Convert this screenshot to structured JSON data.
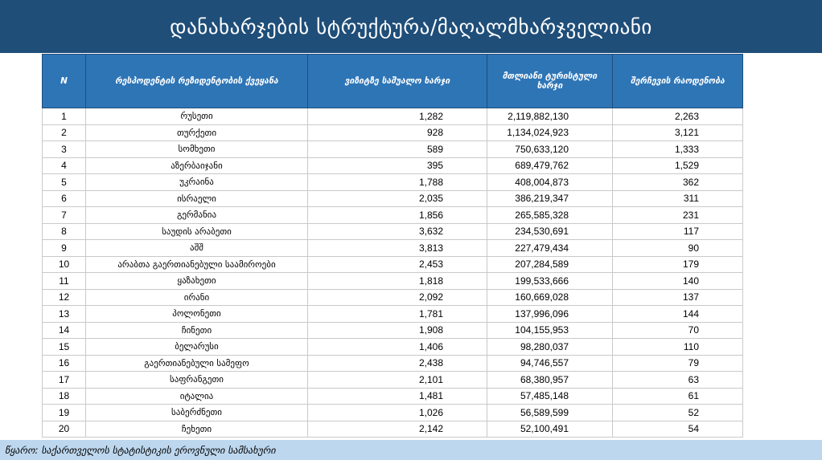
{
  "title": "დანახარჯების სტრუქტურა/მაღალმხარჯველიანი",
  "table": {
    "headers": [
      "N",
      "რესპოდენტის რეზიდენტობის ქვეყანა",
      "ვიზიტზე საშუალო ხარჯი",
      "მთლიანი ტურისტული ხარჯი",
      "შერჩევის რაოდენობა"
    ],
    "rows": [
      {
        "n": "1",
        "country": "რუსეთი",
        "avg": "1,282",
        "total": "2,119,882,130",
        "sample": "2,263"
      },
      {
        "n": "2",
        "country": "თურქეთი",
        "avg": "928",
        "total": "1,134,024,923",
        "sample": "3,121"
      },
      {
        "n": "3",
        "country": "სომხეთი",
        "avg": "589",
        "total": "750,633,120",
        "sample": "1,333"
      },
      {
        "n": "4",
        "country": "აზერბაიჯანი",
        "avg": "395",
        "total": "689,479,762",
        "sample": "1,529"
      },
      {
        "n": "5",
        "country": "უკრაინა",
        "avg": "1,788",
        "total": "408,004,873",
        "sample": "362"
      },
      {
        "n": "6",
        "country": "ისრაელი",
        "avg": "2,035",
        "total": "386,219,347",
        "sample": "311"
      },
      {
        "n": "7",
        "country": "გერმანია",
        "avg": "1,856",
        "total": "265,585,328",
        "sample": "231"
      },
      {
        "n": "8",
        "country": "საუდის არაბეთი",
        "avg": "3,632",
        "total": "234,530,691",
        "sample": "117"
      },
      {
        "n": "9",
        "country": "აშშ",
        "avg": "3,813",
        "total": "227,479,434",
        "sample": "90"
      },
      {
        "n": "10",
        "country": "არაბთა გაერთიანებული საამიროები",
        "avg": "2,453",
        "total": "207,284,589",
        "sample": "179"
      },
      {
        "n": "11",
        "country": "ყაზახეთი",
        "avg": "1,818",
        "total": "199,533,666",
        "sample": "140"
      },
      {
        "n": "12",
        "country": "ირანი",
        "avg": "2,092",
        "total": "160,669,028",
        "sample": "137"
      },
      {
        "n": "13",
        "country": "პოლონეთი",
        "avg": "1,781",
        "total": "137,996,096",
        "sample": "144"
      },
      {
        "n": "14",
        "country": "ჩინეთი",
        "avg": "1,908",
        "total": "104,155,953",
        "sample": "70"
      },
      {
        "n": "15",
        "country": "ბელარუსი",
        "avg": "1,406",
        "total": "98,280,037",
        "sample": "110"
      },
      {
        "n": "16",
        "country": "გაერთიანებული სამეფო",
        "avg": "2,438",
        "total": "94,746,557",
        "sample": "79"
      },
      {
        "n": "17",
        "country": "საფრანგეთი",
        "avg": "2,101",
        "total": "68,380,957",
        "sample": "63"
      },
      {
        "n": "18",
        "country": "იტალია",
        "avg": "1,481",
        "total": "57,485,148",
        "sample": "61"
      },
      {
        "n": "19",
        "country": "საბერძნეთი",
        "avg": "1,026",
        "total": "56,589,599",
        "sample": "52"
      },
      {
        "n": "20",
        "country": "ჩეხეთი",
        "avg": "2,142",
        "total": "52,100,491",
        "sample": "54"
      }
    ]
  },
  "source": "წყარო: საქართველოს სტატისტიკის ეროვნული სამსახური",
  "colors": {
    "title_bg": "#1f4e79",
    "header_bg": "#2e75b6",
    "source_bg": "#bdd7ee"
  }
}
